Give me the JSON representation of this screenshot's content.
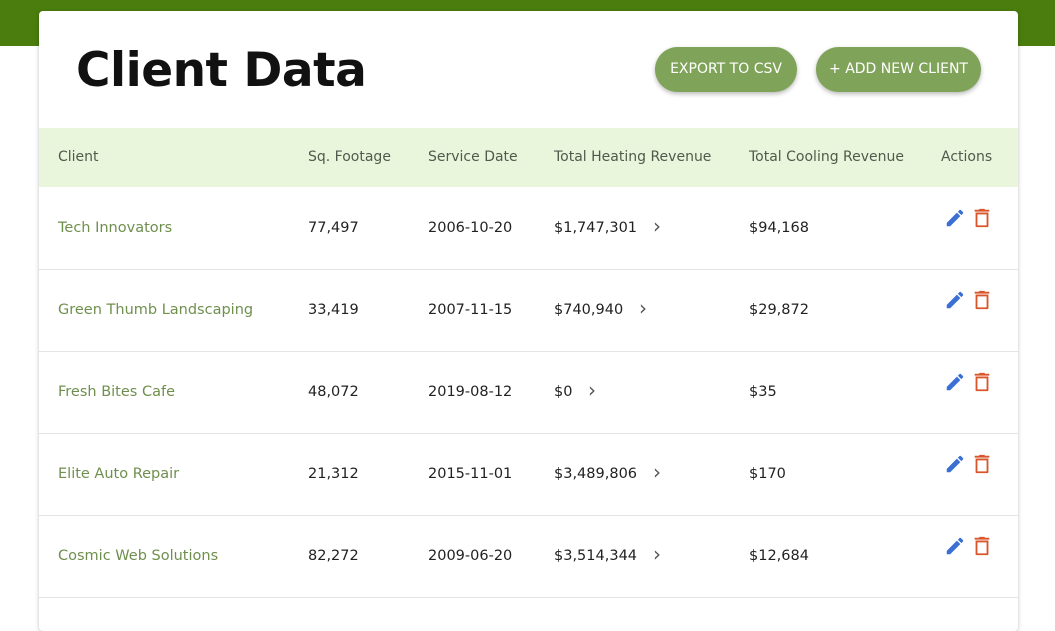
{
  "page": {
    "title": "Client Data",
    "export_label": "EXPORT TO CSV",
    "add_label": "+ ADD NEW CLIENT"
  },
  "colors": {
    "top_bar": "#4a7d0d",
    "button": "#80a35a",
    "header_row": "#eaf6dc",
    "client_text": "#6f8f4e",
    "edit_icon": "#3a6fd6",
    "delete_icon": "#d9552a"
  },
  "table": {
    "columns": [
      "Client",
      "Sq. Footage",
      "Service Date",
      "Total Heating Revenue",
      "Total Cooling Revenue",
      "Actions"
    ],
    "rows": [
      {
        "client": "Tech Innovators",
        "sqft": "77,497",
        "date": "2006-10-20",
        "heating": "$1,747,301",
        "cooling": "$94,168"
      },
      {
        "client": "Green Thumb Landscaping",
        "sqft": "33,419",
        "date": "2007-11-15",
        "heating": "$740,940",
        "cooling": "$29,872"
      },
      {
        "client": "Fresh Bites Cafe",
        "sqft": "48,072",
        "date": "2019-08-12",
        "heating": "$0",
        "cooling": "$35"
      },
      {
        "client": "Elite Auto Repair",
        "sqft": "21,312",
        "date": "2015-11-01",
        "heating": "$3,489,806",
        "cooling": "$170"
      },
      {
        "client": "Cosmic Web Solutions",
        "sqft": "82,272",
        "date": "2009-06-20",
        "heating": "$3,514,344",
        "cooling": "$12,684"
      }
    ],
    "icons": {
      "expand": "chevron-right-icon",
      "edit": "pencil-icon",
      "delete": "trash-icon"
    }
  }
}
